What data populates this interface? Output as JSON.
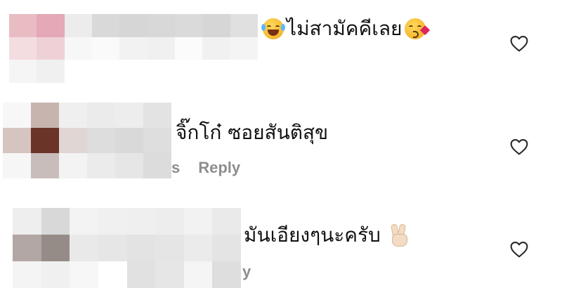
{
  "comments": [
    {
      "text": "ไม่สามัคคีเลย",
      "lead_emoji": "face-with-tears-of-joy-icon",
      "trail_emoji": "face-blowing-a-kiss-icon",
      "meta_fragment": "",
      "reply_label": "",
      "like_icon": "heart-outline-icon",
      "avatar_blur": {
        "cols": 9,
        "colors": [
          "#e9bcc4",
          "#e4a8b6",
          "#ececec",
          "#d9d9d9",
          "#d6d6d6",
          "#d8d8d8",
          "#dadada",
          "#d6d6d6",
          "#e0e0e0",
          "#f4dde1",
          "#eed1d7",
          "#f7f7f7",
          "#fafafa",
          "#f2f2f2",
          "#f0f0f0",
          "#fbfbfb",
          "#f1f1f1",
          "#f4f4f4",
          "#f5f5f5",
          "#f0f0f0",
          "#ffffff",
          "#ffffff",
          "#ffffff",
          "#ffffff",
          "#ffffff",
          "#ffffff",
          "#ffffff"
        ]
      }
    },
    {
      "text": "จิ๊กโก๋ ซอยสันติสุข",
      "lead_emoji": "",
      "trail_emoji": "",
      "meta_fragment": "s",
      "reply_label": "Reply",
      "like_icon": "heart-outline-icon",
      "avatar_blur": {
        "cols": 6,
        "colors": [
          "#f7f7f7",
          "#c8b4ae",
          "#efefef",
          "#ebebeb",
          "#ededed",
          "#e3e3e3",
          "#d6c4c0",
          "#6a3429",
          "#e0d6d4",
          "#dddddd",
          "#d9d9d9",
          "#dedede",
          "#f6f6f6",
          "#c9bdbb",
          "#f3f3f3",
          "#ebebeb",
          "#e6e6e6",
          "#dcdcdc"
        ]
      }
    },
    {
      "text": "มันเอียงๆนะครับ",
      "lead_emoji": "",
      "trail_emoji": "victory-hand-icon",
      "meta_fragment": "y",
      "reply_label": "",
      "like_icon": "heart-outline-icon",
      "avatar_blur": {
        "cols": 8,
        "colors": [
          "#eeeeee",
          "#d8d8d8",
          "#f3f3f3",
          "#f0f0f0",
          "#efefef",
          "#ededed",
          "#f2f2f2",
          "#eaeaea",
          "#b2a7a4",
          "#968c87",
          "#e9e9e9",
          "#e6e6e6",
          "#e3e3e3",
          "#e5e5e5",
          "#ebebeb",
          "#e4e4e4",
          "#f4f4f4",
          "#f0f0f0",
          "#f7f7f7",
          "#ffffff",
          "#e1e1e1",
          "#e6e6e6",
          "#f5f5f5",
          "#dedede"
        ]
      }
    }
  ],
  "colors": {
    "text": "#111111",
    "secondary": "#8e8e8e",
    "heart_stroke": "#262626"
  }
}
